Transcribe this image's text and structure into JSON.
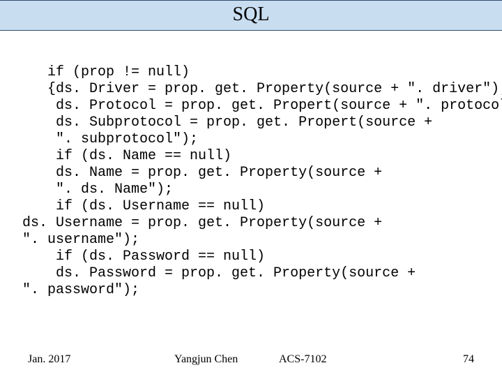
{
  "title": "SQL",
  "code": "   if (prop != null)\n   {ds. Driver = prop. get. Property(source + \". driver\");\n    ds. Protocol = prop. get. Propert(source + \". protocol\");\n    ds. Subprotocol = prop. get. Propert(source +\n    \". subprotocol\");\n    if (ds. Name == null)\n    ds. Name = prop. get. Property(source +\n    \". ds. Name\");\n    if (ds. Username == null)\nds. Username = prop. get. Property(source +\n\". username\");\n    if (ds. Password == null)\n    ds. Password = prop. get. Property(source +\n\". password\");",
  "footer": {
    "date": "Jan. 2017",
    "author": "Yangjun Chen",
    "course": "ACS-7102",
    "page": "74"
  }
}
